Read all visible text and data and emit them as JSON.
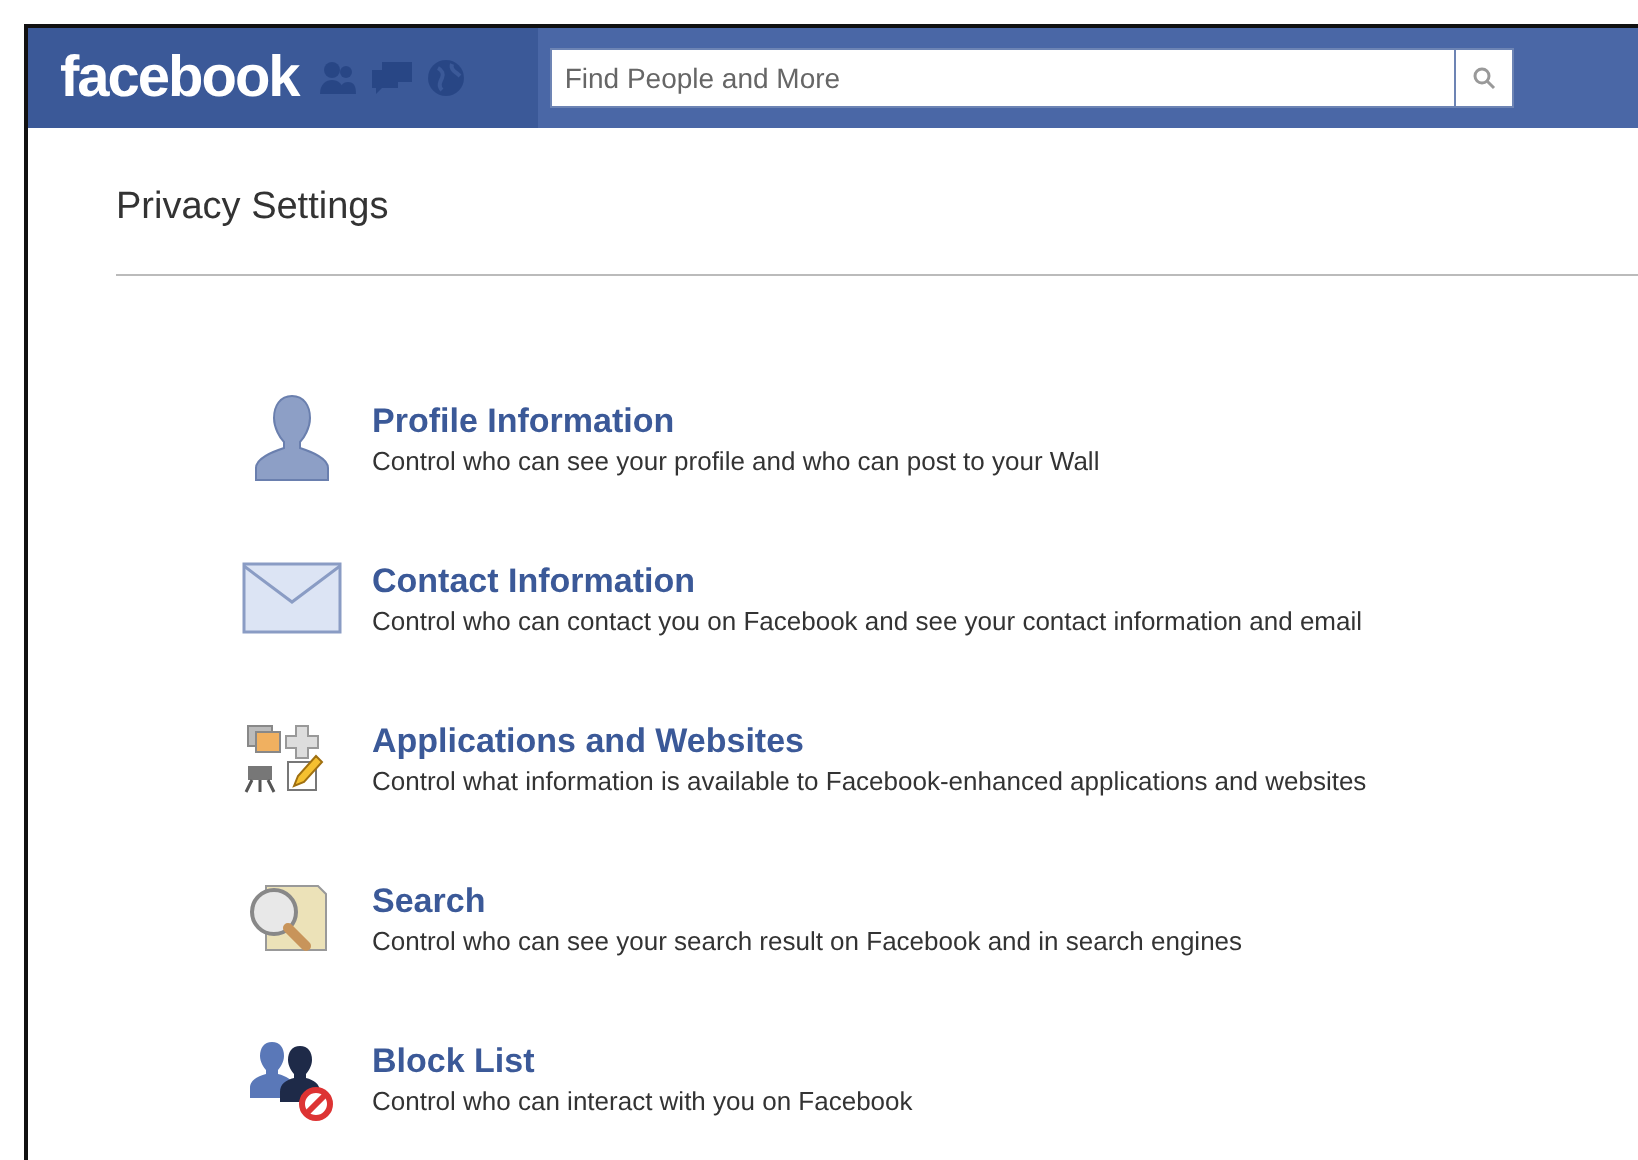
{
  "header": {
    "logo": "facebook",
    "search": {
      "placeholder": "Find People and More"
    }
  },
  "page_title": "Privacy Settings",
  "sections": [
    {
      "kind": "profile",
      "title": "Profile Information",
      "description": "Control who can see your profile and who can post to your Wall"
    },
    {
      "kind": "contact",
      "title": "Contact Information",
      "description": "Control who can contact you on Facebook and see your contact information and email"
    },
    {
      "kind": "apps",
      "title": "Applications and Websites",
      "description": "Control what information is available to Facebook-enhanced applications and websites"
    },
    {
      "kind": "search",
      "title": "Search",
      "description": "Control who can see your search result on Facebook and in search engines"
    },
    {
      "kind": "block",
      "title": "Block List",
      "description": "Control who can interact with you on Facebook"
    }
  ]
}
